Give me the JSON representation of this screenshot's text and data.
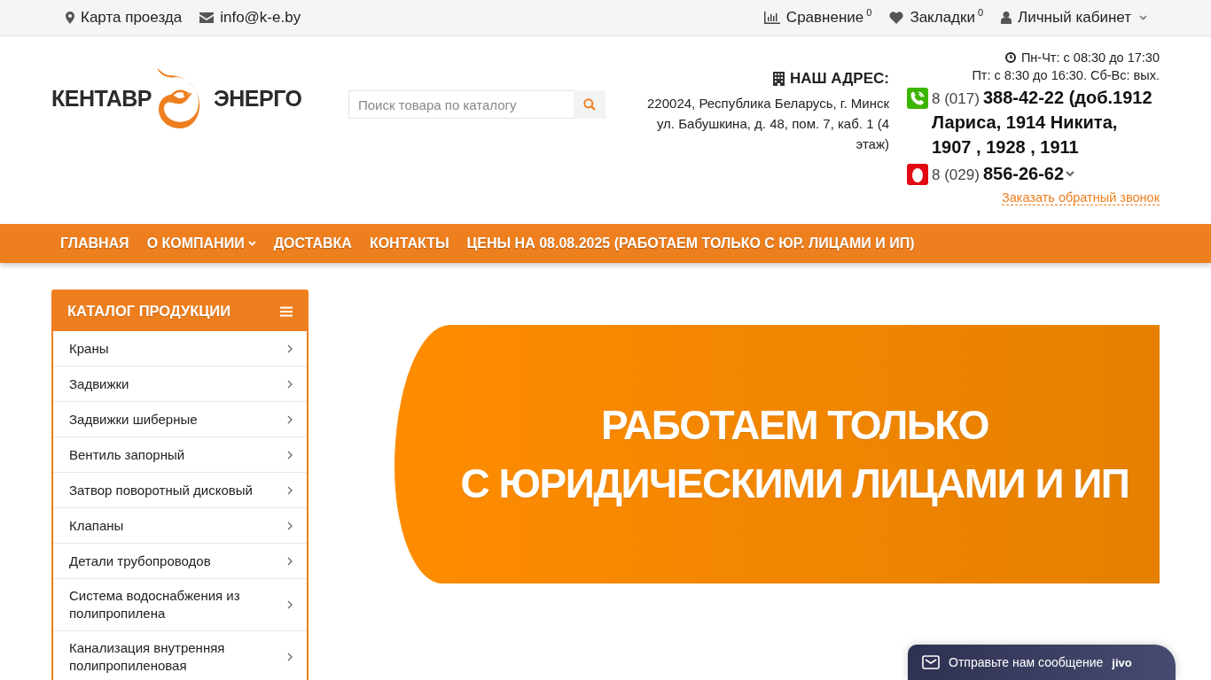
{
  "topbar": {
    "left": [
      {
        "kind": "map",
        "label": "Карта проезда"
      },
      {
        "kind": "mail",
        "label": "info@k-e.by"
      }
    ],
    "right": [
      {
        "kind": "compare",
        "label": "Сравнение",
        "count": "0"
      },
      {
        "kind": "bookmarks",
        "label": "Закладки",
        "count": "0"
      },
      {
        "kind": "account",
        "label": "Личный кабинет",
        "dropdown": true
      }
    ]
  },
  "logo": {
    "left": "КЕНТАВР",
    "right": "ЭНЕРГО"
  },
  "search": {
    "placeholder": "Поиск товара по каталогу"
  },
  "address": {
    "title": "НАШ АДРЕС:",
    "text": "220024, Республика Беларусь, г. Минск ул. Бабушкина, д. 48, пом. 7, каб. 1 (4 этаж)"
  },
  "hours": [
    "Пн-Чт: с 08:30 до 17:30",
    "Пт: с 8:30 до 16:30. Сб-Вс: вых."
  ],
  "phones": [
    {
      "kind": "landline",
      "prefix": "8 (017)",
      "number": "388-42-22 (доб.1912 Лариса, 1914 Никита, 1907 , 1928 , 1911",
      "dropdown": false
    },
    {
      "kind": "mobile",
      "prefix": "8 (029)",
      "number": "856-26-62",
      "dropdown": true
    }
  ],
  "callback": "Заказать обратный звонок",
  "nav": [
    {
      "label": "ГЛАВНАЯ",
      "dropdown": false
    },
    {
      "label": "О КОМПАНИИ",
      "dropdown": true
    },
    {
      "label": "ДОСТАВКА",
      "dropdown": false
    },
    {
      "label": "КОНТАКТЫ",
      "dropdown": false
    },
    {
      "label": "ЦЕНЫ НА 08.08.2025 (РАБОТАЕМ ТОЛЬКО С ЮР. ЛИЦАМИ И ИП)",
      "dropdown": false
    }
  ],
  "catalog": {
    "title": "КАТАЛОГ ПРОДУКЦИИ",
    "items": [
      "Краны",
      "Задвижки",
      "Задвижки шиберные",
      "Вентиль запорный",
      "Затвор поворотный дисковый",
      "Клапаны",
      "Детали трубопроводов",
      "Система водоснабжения из полипропилена",
      "Канализация внутренняя полипропиленовая"
    ]
  },
  "banner": {
    "lines": [
      "РАБОТАЕМ ТОЛЬКО",
      "С ЮРИДИЧЕСКИМИ ЛИЦАМИ И ИП"
    ]
  },
  "chat": {
    "label": "Отправьте нам сообщение",
    "brand": "jivo"
  }
}
